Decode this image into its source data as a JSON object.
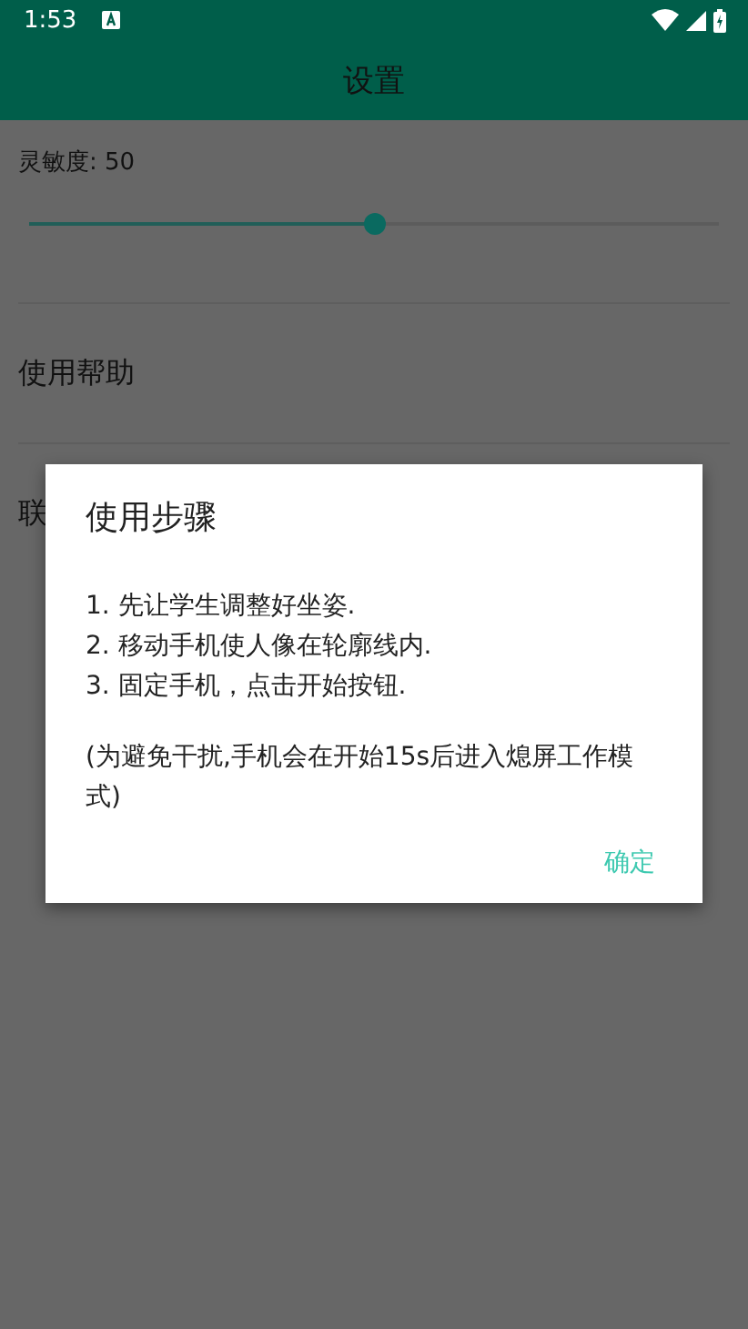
{
  "status_bar": {
    "time": "1:53"
  },
  "toolbar": {
    "title": "设置"
  },
  "sensitivity": {
    "label": "灵敏度: 50",
    "level": 0.5
  },
  "items": [
    {
      "label": "使用帮助"
    },
    {
      "label": "联"
    }
  ],
  "dialog": {
    "title": "使用步骤",
    "steps": [
      "1. 先让学生调整好坐姿.",
      "2. 移动手机使人像在轮廓线内.",
      "3. 固定手机，点击开始按钮."
    ],
    "note": "(为避免干扰,手机会在开始15s后进入熄屏工作模式)",
    "button": "确定"
  }
}
